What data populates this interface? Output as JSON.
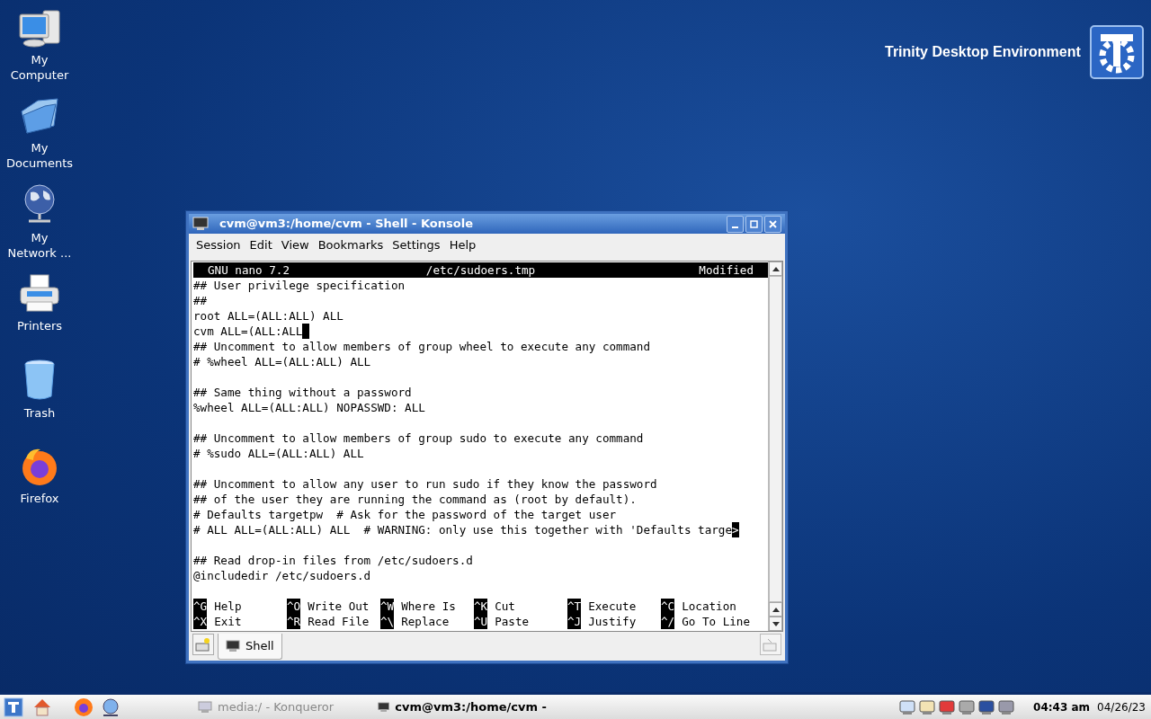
{
  "desktop": {
    "logo_text": "Trinity Desktop Environment",
    "icons": [
      {
        "kind": "computer",
        "lines": [
          "My",
          "Computer"
        ]
      },
      {
        "kind": "documents",
        "lines": [
          "My",
          "Documents"
        ]
      },
      {
        "kind": "network",
        "lines": [
          "My",
          "Network ..."
        ]
      },
      {
        "kind": "printer",
        "lines": [
          "Printers"
        ]
      },
      {
        "kind": "trash",
        "lines": [
          "Trash"
        ]
      },
      {
        "kind": "firefox",
        "lines": [
          "Firefox"
        ]
      }
    ]
  },
  "window": {
    "title": "cvm@vm3:/home/cvm - Shell - Konsole",
    "menu": [
      "Session",
      "Edit",
      "View",
      "Bookmarks",
      "Settings",
      "Help"
    ],
    "terminal": {
      "header": {
        "app": "GNU nano 7.2",
        "file": "/etc/sudoers.tmp",
        "status": "Modified"
      },
      "lines": [
        {
          "kind": "text",
          "text": "## User privilege specification"
        },
        {
          "kind": "text",
          "text": "##"
        },
        {
          "kind": "text",
          "text": "root ALL=(ALL:ALL) ALL"
        },
        {
          "kind": "text",
          "text": "cvm ALL=(ALL:ALL",
          "cursor": true
        },
        {
          "kind": "text",
          "text": "## Uncomment to allow members of group wheel to execute any command"
        },
        {
          "kind": "text",
          "text": "# %wheel ALL=(ALL:ALL) ALL"
        },
        {
          "kind": "blank"
        },
        {
          "kind": "text",
          "text": "## Same thing without a password"
        },
        {
          "kind": "text",
          "text": "%wheel ALL=(ALL:ALL) NOPASSWD: ALL"
        },
        {
          "kind": "blank"
        },
        {
          "kind": "text",
          "text": "## Uncomment to allow members of group sudo to execute any command"
        },
        {
          "kind": "text",
          "text": "# %sudo ALL=(ALL:ALL) ALL"
        },
        {
          "kind": "blank"
        },
        {
          "kind": "text",
          "text": "## Uncomment to allow any user to run sudo if they know the password"
        },
        {
          "kind": "text",
          "text": "## of the user they are running the command as (root by default)."
        },
        {
          "kind": "text",
          "text": "# Defaults targetpw  # Ask for the password of the target user"
        },
        {
          "kind": "text",
          "text": "# ALL ALL=(ALL:ALL) ALL  # WARNING: only use this together with 'Defaults targe",
          "more": ">"
        },
        {
          "kind": "blank"
        },
        {
          "kind": "text",
          "text": "## Read drop-in files from /etc/sudoers.d"
        },
        {
          "kind": "text",
          "text": "@includedir /etc/sudoers.d"
        },
        {
          "kind": "blank"
        }
      ],
      "shortcuts": [
        [
          {
            "key": "^G",
            "label": "Help"
          },
          {
            "key": "^O",
            "label": "Write Out"
          },
          {
            "key": "^W",
            "label": "Where Is"
          },
          {
            "key": "^K",
            "label": "Cut"
          },
          {
            "key": "^T",
            "label": "Execute"
          },
          {
            "key": "^C",
            "label": "Location"
          }
        ],
        [
          {
            "key": "^X",
            "label": "Exit"
          },
          {
            "key": "^R",
            "label": "Read File"
          },
          {
            "key": "^\\",
            "label": "Replace"
          },
          {
            "key": "^U",
            "label": "Paste"
          },
          {
            "key": "^J",
            "label": "Justify"
          },
          {
            "key": "^/",
            "label": "Go To Line"
          }
        ]
      ]
    },
    "tabs": [
      {
        "label": "Shell",
        "selected": true
      }
    ]
  },
  "taskbar": {
    "tasks": [
      {
        "label": "media:/ - Konqueror",
        "selected": false
      },
      {
        "label": "cvm@vm3:/home/cvm -",
        "selected": true
      }
    ],
    "clock": {
      "time": "04:43 am",
      "date": "04/26/23"
    }
  }
}
